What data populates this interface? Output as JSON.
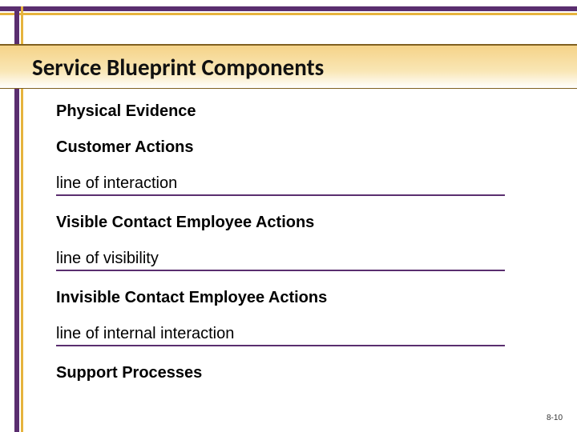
{
  "title": "Service Blueprint Components",
  "sections": {
    "physical_evidence": "Physical Evidence",
    "customer_actions": "Customer Actions",
    "line_interaction": "line of interaction",
    "visible_contact": "Visible Contact Employee Actions",
    "line_visibility": "line of visibility",
    "invisible_contact": "Invisible Contact Employee Actions",
    "line_internal": "line of internal interaction",
    "support_processes": "Support Processes"
  },
  "page_number": "8-10"
}
